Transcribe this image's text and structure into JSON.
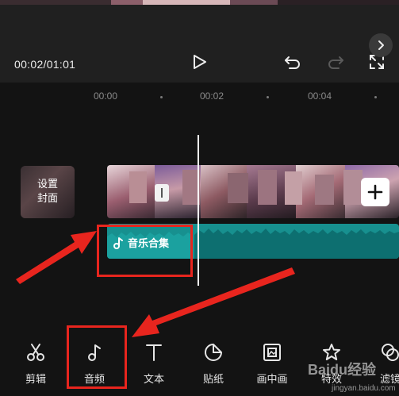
{
  "player": {
    "time_readout": "00:02/01:01"
  },
  "ruler": {
    "ticks": [
      "00:00",
      "00:02",
      "00:04"
    ]
  },
  "cover": {
    "label_line1": "设置",
    "label_line2": "封面"
  },
  "audio_track": {
    "label": "音乐合集"
  },
  "toolbar": {
    "items": [
      {
        "label": "剪辑",
        "icon": "scissors-icon"
      },
      {
        "label": "音频",
        "icon": "music-note-icon"
      },
      {
        "label": "文本",
        "icon": "text-icon"
      },
      {
        "label": "贴纸",
        "icon": "sticker-icon"
      },
      {
        "label": "画中画",
        "icon": "picture-in-picture-icon"
      },
      {
        "label": "特效",
        "icon": "effects-star-icon"
      },
      {
        "label": "滤镜",
        "icon": "filter-icon"
      }
    ]
  },
  "watermark": {
    "brand": "Baidu经验",
    "url": "jingyan.baidu.com"
  },
  "colors": {
    "background": "#131313",
    "panel": "#202020",
    "audio_track": "#17908f",
    "annotation_red": "#e8251e"
  }
}
